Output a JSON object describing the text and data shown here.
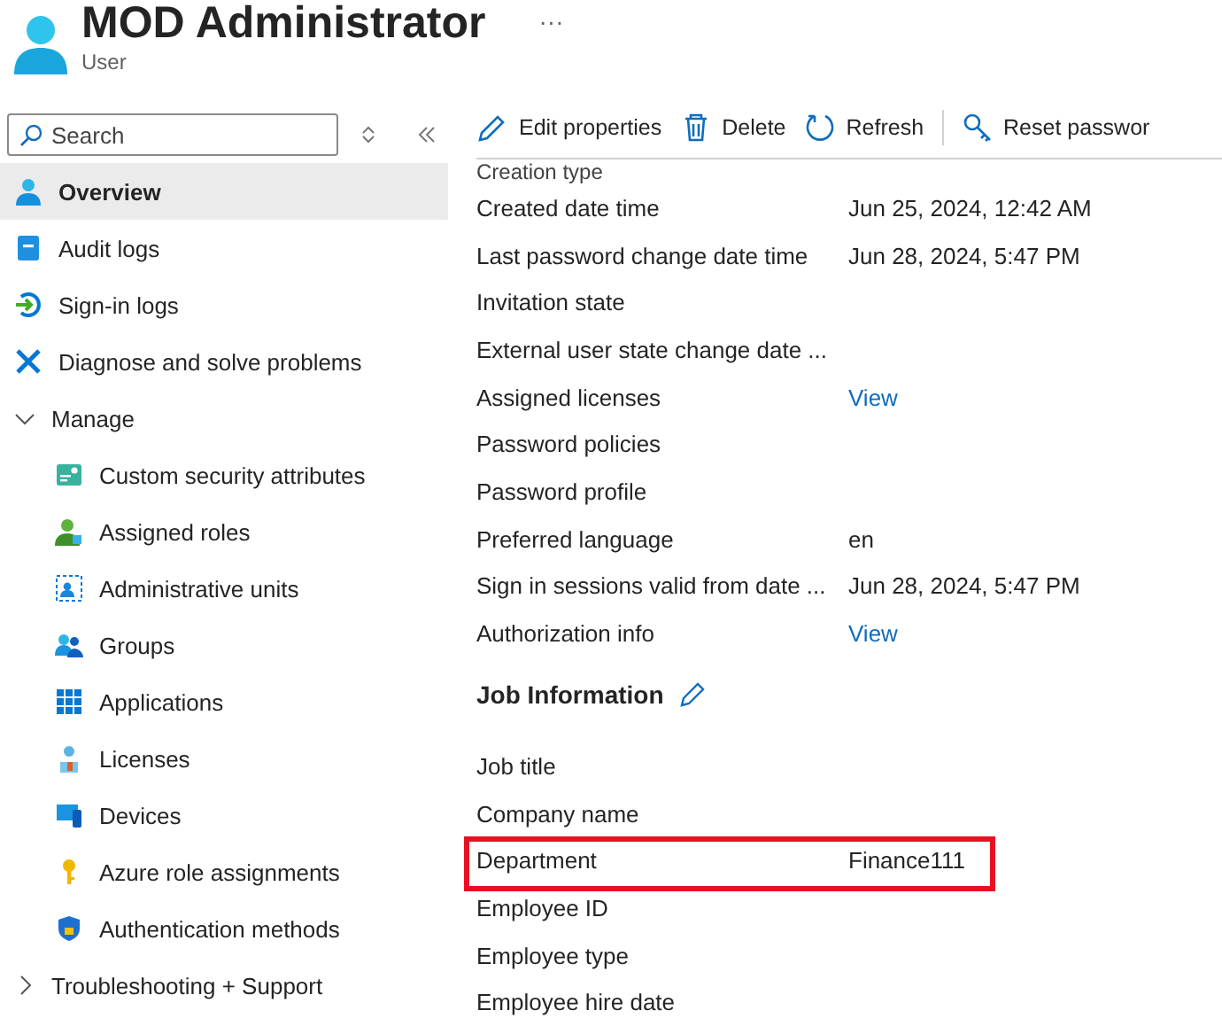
{
  "header": {
    "title": "MOD Administrator",
    "subtitle": "User",
    "more": "···"
  },
  "sidebar": {
    "search": {
      "placeholder": "Search"
    },
    "items": [
      {
        "kind": "item",
        "label": "Overview",
        "selected": true
      },
      {
        "kind": "item",
        "label": "Audit logs",
        "selected": false
      },
      {
        "kind": "item",
        "label": "Sign-in logs",
        "selected": false
      },
      {
        "kind": "item",
        "label": "Diagnose and solve problems",
        "selected": false
      },
      {
        "kind": "group",
        "label": "Manage",
        "expanded": true,
        "selected": false,
        "children": [
          {
            "label": "Custom security attributes",
            "selected": false
          },
          {
            "label": "Assigned roles",
            "selected": false
          },
          {
            "label": "Administrative units",
            "selected": false
          },
          {
            "label": "Groups",
            "selected": false
          },
          {
            "label": "Applications",
            "selected": false
          },
          {
            "label": "Licenses",
            "selected": false
          },
          {
            "label": "Devices",
            "selected": false
          },
          {
            "label": "Azure role assignments",
            "selected": false
          },
          {
            "label": "Authentication methods",
            "selected": false
          }
        ]
      },
      {
        "kind": "group",
        "label": "Troubleshooting + Support",
        "expanded": false,
        "selected": false
      }
    ]
  },
  "toolbar": [
    {
      "label": "Edit properties"
    },
    {
      "label": "Delete"
    },
    {
      "label": "Refresh"
    },
    {
      "label": "Reset passwor"
    }
  ],
  "properties": [
    {
      "kind": "row",
      "label": "Creation type",
      "cut": true
    },
    {
      "kind": "row",
      "label": "Created date time",
      "value": "Jun 25, 2024, 12:42 AM"
    },
    {
      "kind": "row",
      "label": "Last password change date time",
      "value": "Jun 28, 2024, 5:47 PM"
    },
    {
      "kind": "row",
      "label": "Invitation state"
    },
    {
      "kind": "row",
      "label": "External user state change date ..."
    },
    {
      "kind": "row",
      "label": "Assigned licenses",
      "link": "View"
    },
    {
      "kind": "row",
      "label": "Password policies"
    },
    {
      "kind": "row",
      "label": "Password profile"
    },
    {
      "kind": "row",
      "label": "Preferred language",
      "value": "en"
    },
    {
      "kind": "row",
      "label": "Sign in sessions valid from date ...",
      "value": "Jun 28, 2024, 5:47 PM"
    },
    {
      "kind": "row",
      "label": "Authorization info",
      "link": "View"
    },
    {
      "kind": "section",
      "label": "Job Information"
    },
    {
      "kind": "row",
      "label": "Job title"
    },
    {
      "kind": "row",
      "label": "Company name"
    },
    {
      "kind": "row",
      "label": "Department",
      "value": "Finance111",
      "highlighted": true
    },
    {
      "kind": "row",
      "label": "Employee ID"
    },
    {
      "kind": "row",
      "label": "Employee type"
    },
    {
      "kind": "row",
      "label": "Employee hire date"
    }
  ]
}
